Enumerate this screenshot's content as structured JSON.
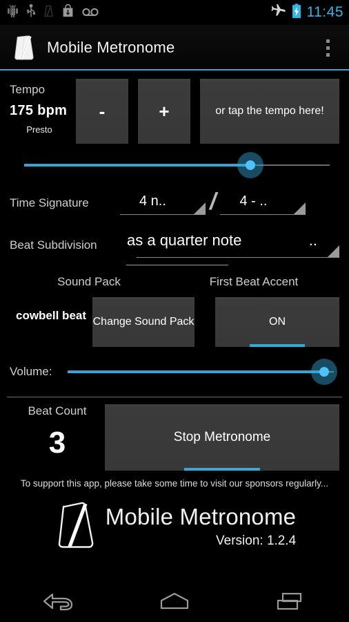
{
  "status_bar": {
    "icons": [
      "android-debug-icon",
      "usb-icon",
      "metronome-running-icon",
      "download-bag-icon",
      "voicemail-icon"
    ],
    "right_icons": [
      "airplane-mode-icon",
      "battery-charging-icon"
    ],
    "time": "11:45",
    "accent_color": "#33b5e5"
  },
  "action_bar": {
    "app_icon": "metronome-icon",
    "title": "Mobile Metronome",
    "overflow": "overflow-menu-icon",
    "accent_color": "#33a9dc"
  },
  "tempo": {
    "label": "Tempo",
    "bpm": "175 bpm",
    "marking": "Presto",
    "decrease_label": "-",
    "increase_label": "+",
    "tap_label": "or tap the tempo here!",
    "slider_percent": 74
  },
  "time_signature": {
    "label": "Time Signature",
    "numerator": "4    n..",
    "separator": "/",
    "denominator": "4   -  .."
  },
  "beat_subdivision": {
    "label": "Beat Subdivision",
    "value": "as a quarter note",
    "trailing": ".."
  },
  "sound_pack": {
    "label": "Sound Pack",
    "value": "cowbell\nbeat",
    "change_label": "Change\nSound Pack"
  },
  "first_beat_accent": {
    "label": "First Beat Accent",
    "state": "ON"
  },
  "volume": {
    "label": "Volume:",
    "slider_percent": 100
  },
  "beat_count": {
    "label": "Beat Count",
    "value": "3"
  },
  "transport": {
    "stop_label": "Stop Metronome"
  },
  "sponsor_note": "To support this app, please take some time to visit our sponsors regularly...",
  "footer": {
    "brand": "Mobile Metronome",
    "version": "Version: 1.2.4",
    "logo": "metronome-logo-icon"
  },
  "nav_bar": {
    "back": "back-icon",
    "home": "home-icon",
    "recents": "recents-icon"
  }
}
